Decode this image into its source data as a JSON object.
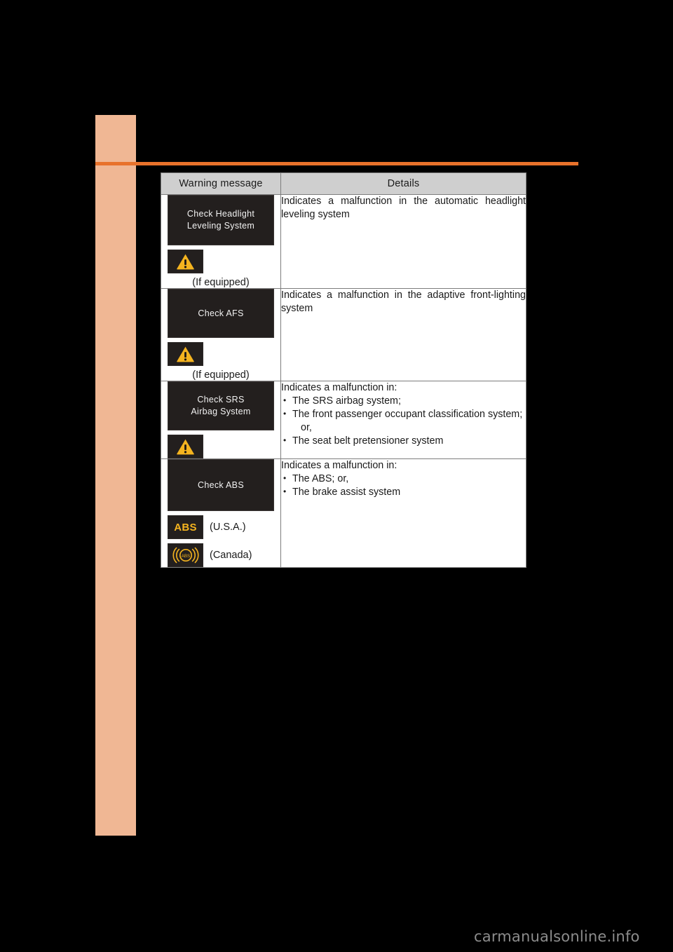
{
  "page": {
    "background_color": "#000000",
    "accent_bar_color": "#F0B794",
    "accent_rule_color": "#E8722B",
    "watermark": "carmanualsonline.info"
  },
  "table": {
    "headers": {
      "message": "Warning message",
      "details": "Details"
    },
    "rows": [
      {
        "display_message": "Check Headlight\nLeveling System",
        "display_line1": "Check Headlight",
        "display_line2": "Leveling System",
        "icons": [
          {
            "name": "warning-triangle-icon",
            "caption": ""
          }
        ],
        "note": "(If equipped)",
        "details_lead": "Indicates a malfunction in the automatic headlight leveling system",
        "details_bullets": []
      },
      {
        "display_message": "Check AFS",
        "display_line1": "Check AFS",
        "display_line2": "",
        "icons": [
          {
            "name": "warning-triangle-icon",
            "caption": ""
          }
        ],
        "note": "(If equipped)",
        "details_lead": "Indicates a malfunction in the adaptive front-lighting system",
        "details_bullets": []
      },
      {
        "display_message": "Check SRS\nAirbag System",
        "display_line1": "Check SRS",
        "display_line2": "Airbag System",
        "icons": [
          {
            "name": "warning-triangle-icon",
            "caption": ""
          }
        ],
        "note": "",
        "details_lead": "Indicates a malfunction in:",
        "details_bullets": [
          "The SRS airbag system;",
          "The front passenger occupant classification system;",
          "or,",
          "The seat belt pretensioner system"
        ]
      },
      {
        "display_message": "Check ABS",
        "display_line1": "Check ABS",
        "display_line2": "",
        "icons": [
          {
            "name": "abs-text-icon",
            "caption": "(U.S.A.)",
            "label": "ABS"
          },
          {
            "name": "abs-circle-icon",
            "caption": "(Canada)",
            "label": "ABS"
          }
        ],
        "note": "",
        "details_lead": "Indicates a malfunction in:",
        "details_bullets": [
          "The ABS; or,",
          "The brake assist system"
        ]
      }
    ]
  },
  "colors": {
    "lcd_background": "#231f1e",
    "lcd_text": "#f2f2f2",
    "warning_yellow": "#F5B41F",
    "header_fill": "#cfcfcf"
  }
}
